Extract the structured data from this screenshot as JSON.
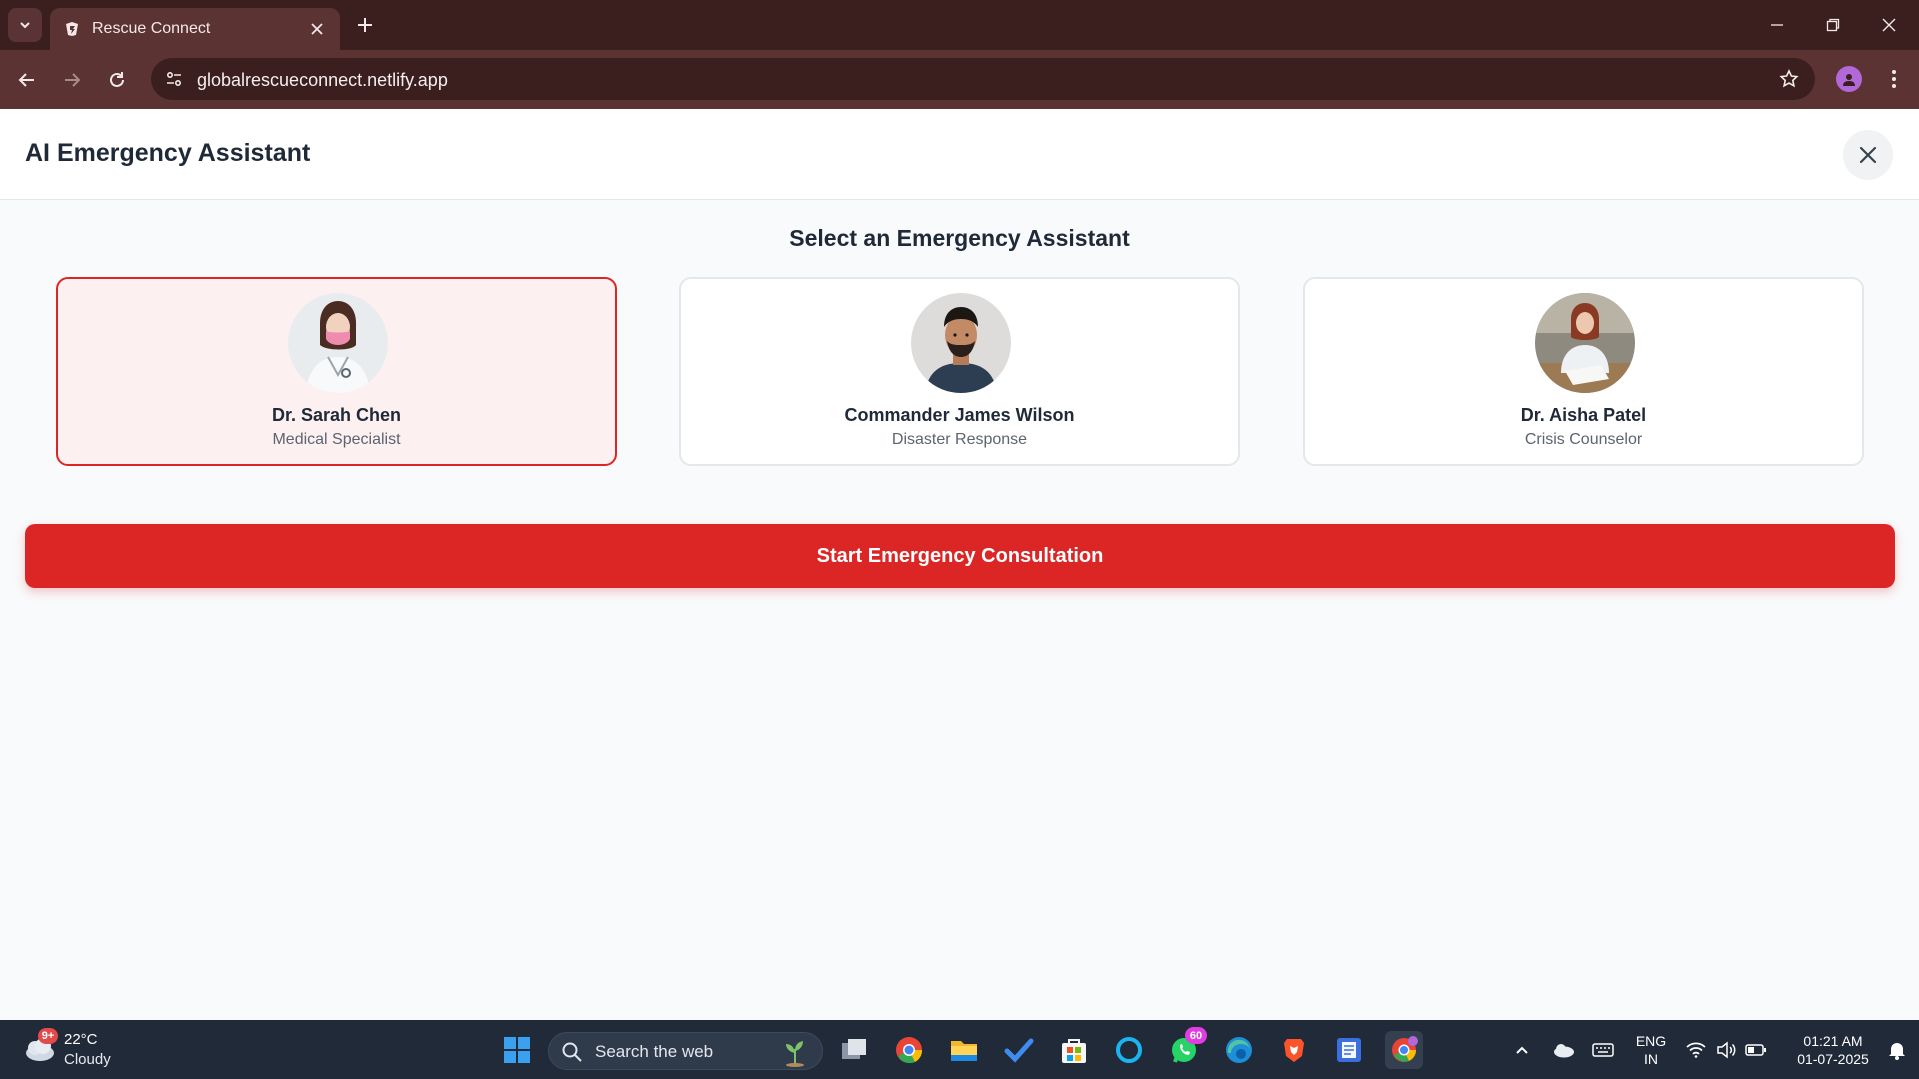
{
  "browser": {
    "tab_title": "Rescue Connect",
    "url": "globalrescueconnect.netlify.app"
  },
  "app": {
    "title": "AI Emergency Assistant",
    "section_title": "Select an Emergency Assistant",
    "assistants": [
      {
        "name": "Dr. Sarah Chen",
        "role": "Medical Specialist",
        "selected": true
      },
      {
        "name": "Commander James Wilson",
        "role": "Disaster Response",
        "selected": false
      },
      {
        "name": "Dr. Aisha Patel",
        "role": "Crisis Counselor",
        "selected": false
      }
    ],
    "start_button": "Start Emergency Consultation",
    "accent_color": "#dc2626"
  },
  "taskbar": {
    "weather_badge": "9+",
    "temperature": "22°C",
    "condition": "Cloudy",
    "search_placeholder": "Search the web",
    "whatsapp_badge": "60",
    "language_line1": "ENG",
    "language_line2": "IN",
    "time": "01:21 AM",
    "date": "01-07-2025"
  }
}
